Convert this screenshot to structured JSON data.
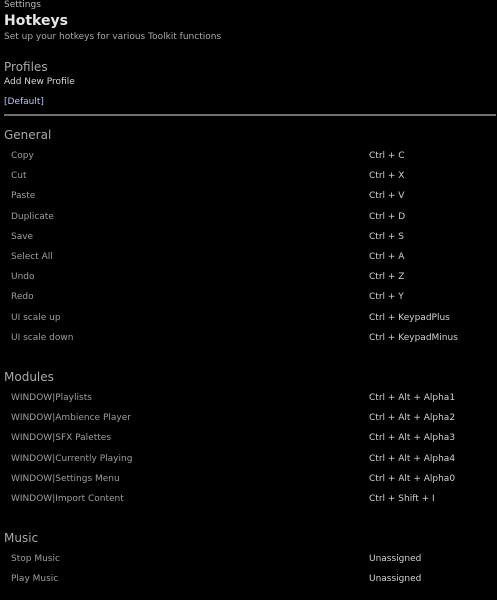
{
  "header": {
    "breadcrumb": "Settings",
    "title": "Hotkeys",
    "subtitle": "Set up your hotkeys for various Toolkit functions"
  },
  "profiles": {
    "heading": "Profiles",
    "add_label": "Add New Profile",
    "items": [
      "[Default]"
    ]
  },
  "general": {
    "heading": "General",
    "rows": [
      {
        "label": "Copy",
        "key": "Ctrl + C"
      },
      {
        "label": "Cut",
        "key": "Ctrl + X"
      },
      {
        "label": "Paste",
        "key": "Ctrl + V"
      },
      {
        "label": "Duplicate",
        "key": "Ctrl + D"
      },
      {
        "label": "Save",
        "key": "Ctrl + S"
      },
      {
        "label": "Select All",
        "key": "Ctrl + A"
      },
      {
        "label": "Undo",
        "key": "Ctrl + Z"
      },
      {
        "label": "Redo",
        "key": "Ctrl + Y"
      },
      {
        "label": "UI scale up",
        "key": "Ctrl + KeypadPlus"
      },
      {
        "label": "UI scale down",
        "key": "Ctrl + KeypadMinus"
      }
    ]
  },
  "modules": {
    "heading": "Modules",
    "rows": [
      {
        "label": "WINDOW|Playlists",
        "key": "Ctrl + Alt + Alpha1"
      },
      {
        "label": "WINDOW|Ambience Player",
        "key": "Ctrl + Alt + Alpha2"
      },
      {
        "label": "WINDOW|SFX Palettes",
        "key": "Ctrl + Alt + Alpha3"
      },
      {
        "label": "WINDOW|Currently Playing",
        "key": "Ctrl + Alt + Alpha4"
      },
      {
        "label": "WINDOW|Settings Menu",
        "key": "Ctrl + Alt + Alpha0"
      },
      {
        "label": "WINDOW|Import Content",
        "key": "Ctrl + Shift + I"
      }
    ]
  },
  "music": {
    "heading": "Music",
    "rows": [
      {
        "label": "Stop Music",
        "key": "Unassigned"
      },
      {
        "label": "Play Music",
        "key": "Unassigned"
      }
    ]
  }
}
